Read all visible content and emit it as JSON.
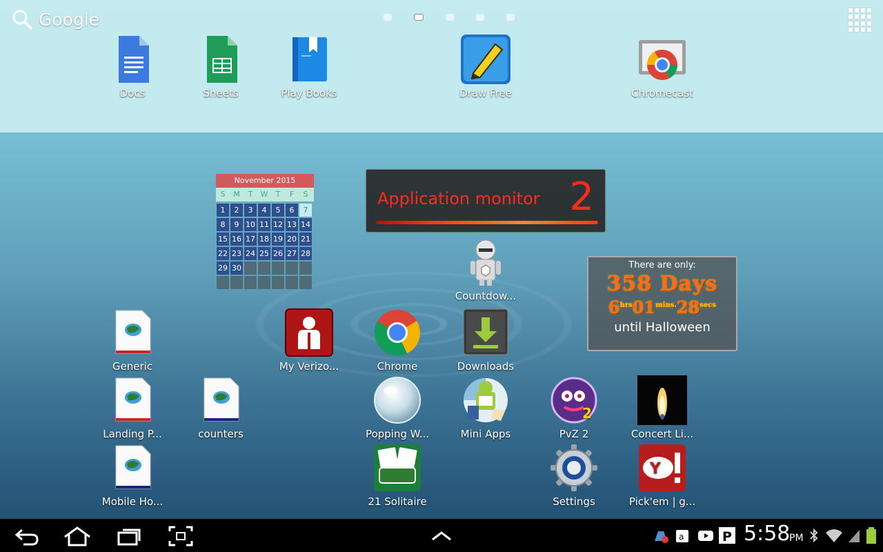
{
  "search": {
    "label": "Google"
  },
  "pages": {
    "count": 5,
    "active": 2
  },
  "top_apps": [
    {
      "label": "Docs"
    },
    {
      "label": "Sheets"
    },
    {
      "label": "Play Books"
    },
    {
      "label": "Draw Free"
    },
    {
      "label": "Chromecast"
    }
  ],
  "calendar": {
    "title": "November 2015",
    "days": [
      "S",
      "M",
      "T",
      "W",
      "T",
      "F",
      "S"
    ],
    "cells": [
      "",
      "",
      "",
      "",
      "",
      "",
      "7",
      "1",
      "2",
      "3",
      "4",
      "5",
      "6",
      "14",
      "8",
      "9",
      "10",
      "11",
      "12",
      "13",
      "21",
      "15",
      "16",
      "17",
      "18",
      "19",
      "20",
      "28",
      "22",
      "23",
      "24",
      "25",
      "26",
      "27",
      "",
      "29",
      "30",
      "",
      "",
      "",
      "",
      "",
      "",
      "",
      "",
      "",
      "",
      ""
    ],
    "weeks": [
      [
        "1",
        "2",
        "3",
        "4",
        "5",
        "6",
        "7"
      ],
      [
        "8",
        "9",
        "10",
        "11",
        "12",
        "13",
        "14"
      ],
      [
        "15",
        "16",
        "17",
        "18",
        "19",
        "20",
        "21"
      ],
      [
        "22",
        "23",
        "24",
        "25",
        "26",
        "27",
        "28"
      ],
      [
        "29",
        "30",
        "",
        "",
        "",
        "",
        ""
      ],
      [
        "",
        "",
        "",
        "",
        "",
        "",
        ""
      ]
    ],
    "today": "7"
  },
  "app_monitor": {
    "title": "Application monitor",
    "count": "2"
  },
  "countdown": {
    "line1": "There are only:",
    "days": "358 Days",
    "hrs": "6",
    "hrs_unit": "hrs",
    "mins": "01",
    "mins_unit": "mins.",
    "secs": "28",
    "secs_unit": "secs",
    "line3": "until Halloween"
  },
  "apps": {
    "countdown_app": "Countdow...",
    "generic": "Generic",
    "my_verizon": "My Verizo...",
    "chrome": "Chrome",
    "downloads": "Downloads",
    "landing": "Landing P...",
    "counters": "counters",
    "popping": "Popping W...",
    "mini_apps": "Mini Apps",
    "pvz2": "PvZ 2",
    "concert": "Concert Li...",
    "mobile_ho": "Mobile Ho...",
    "solitaire": "21 Solitaire",
    "settings": "Settings",
    "pickem": "Pick'em | g..."
  },
  "status": {
    "time": "5:58",
    "ampm": "PM"
  },
  "colors": {
    "accent": "#ff2a1a",
    "calendar_header": "#d35a5a",
    "calendar_cell": "#2e4f8e"
  }
}
